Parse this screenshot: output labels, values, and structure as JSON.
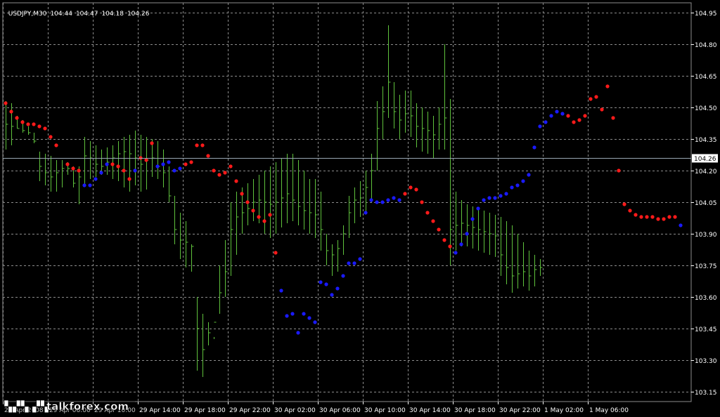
{
  "header": {
    "symbol": "USDJPY,M30",
    "open": "104.44",
    "high": "104.47",
    "low": "104.18",
    "close": "104.26"
  },
  "price_label": "104.26",
  "colors": {
    "background": "#000000",
    "grid": "#8c8c8c",
    "bars": "#5fc23c",
    "sar_above": "#ff1a1a",
    "sar_below": "#1a1aff",
    "axis": "#ffffff",
    "price_line": "#9aa7b4"
  },
  "watermark": {
    "text": "talkforex.com",
    "icon": "logo-watermark"
  },
  "chart_data": {
    "type": "line",
    "title": "USDJPY,M30",
    "ylim": [
      104.1,
      105.0
    ],
    "y_ticks": [
      "104.95",
      "104.80",
      "104.65",
      "104.50",
      "104.35",
      "104.20",
      "104.05",
      "103.90",
      "103.75",
      "103.60",
      "103.45",
      "103.30",
      "103.15"
    ],
    "x_tick_labels": [
      "29 Apr 2008",
      "29 Apr 06:00",
      "29 Apr 10:00",
      "29 Apr 14:00",
      "29 Apr 18:00",
      "29 Apr 22:00",
      "30 Apr 02:00",
      "30 Apr 06:00",
      "30 Apr 10:00",
      "30 Apr 14:00",
      "30 Apr 18:00",
      "30 Apr 22:00",
      "1 May 02:00",
      "1 May 06:00"
    ],
    "grid": true,
    "current_price": 104.26,
    "series": [
      {
        "type": "hlc-bars",
        "high": [
          104.53,
          104.52,
          104.46,
          104.44,
          104.41,
          104.38,
          104.29,
          104.28,
          104.27,
          104.25,
          104.25,
          104.24,
          104.22,
          104.22,
          104.36,
          104.34,
          104.32,
          104.3,
          104.31,
          104.32,
          104.34,
          104.36,
          104.37,
          104.39,
          104.37,
          104.36,
          104.35,
          104.34,
          104.3,
          104.22,
          104.08,
          104.0,
          103.96,
          103.85,
          103.6,
          103.52,
          103.48,
          103.41,
          103.75,
          103.87,
          104.05,
          104.1,
          104.12,
          104.14,
          104.16,
          104.18,
          104.2,
          104.22,
          104.24,
          104.26,
          104.28,
          104.28,
          104.25,
          104.2,
          104.16,
          104.16,
          104.1,
          103.9,
          103.85,
          103.87,
          103.94,
          104.08,
          104.12,
          104.15,
          104.2,
          104.28,
          104.53,
          104.6,
          104.89,
          104.62,
          104.56,
          104.58,
          104.58,
          104.52,
          104.5,
          104.48,
          104.46,
          104.5,
          104.8,
          104.54,
          104.1,
          104.06,
          104.04,
          104.03,
          104.02,
          104.01,
          104.0,
          103.99,
          103.98,
          103.96,
          103.94,
          103.9,
          103.86,
          103.82,
          103.8,
          103.78
        ],
        "low": [
          104.3,
          104.32,
          104.4,
          104.38,
          104.37,
          104.33,
          104.15,
          104.13,
          104.1,
          104.1,
          104.12,
          104.18,
          104.12,
          104.04,
          104.13,
          104.16,
          104.17,
          104.18,
          104.18,
          104.16,
          104.15,
          104.12,
          104.1,
          104.13,
          104.1,
          104.11,
          104.17,
          104.16,
          104.12,
          104.05,
          103.85,
          103.78,
          103.74,
          103.72,
          103.25,
          103.22,
          103.37,
          103.4,
          103.52,
          103.6,
          103.7,
          103.8,
          103.9,
          103.94,
          103.96,
          103.95,
          103.9,
          103.88,
          103.9,
          103.93,
          103.95,
          103.96,
          103.94,
          103.92,
          103.9,
          103.88,
          103.82,
          103.75,
          103.7,
          103.72,
          103.8,
          103.88,
          103.95,
          103.98,
          104.0,
          104.05,
          104.2,
          104.35,
          104.45,
          104.4,
          104.35,
          104.38,
          104.36,
          104.31,
          104.29,
          104.28,
          104.26,
          104.3,
          104.3,
          103.75,
          103.82,
          103.84,
          103.84,
          103.83,
          103.82,
          103.81,
          103.8,
          103.79,
          103.7,
          103.66,
          103.62,
          103.64,
          103.65,
          103.63,
          103.65,
          103.7
        ],
        "close": [
          104.42,
          104.41,
          104.4,
          104.39,
          104.38,
          104.34,
          104.22,
          104.19,
          104.17,
          104.19,
          104.21,
          104.21,
          104.14,
          104.17,
          104.27,
          104.26,
          104.23,
          104.22,
          104.24,
          104.26,
          104.28,
          104.29,
          104.28,
          104.26,
          104.23,
          104.25,
          104.26,
          104.22,
          104.19,
          104.08,
          103.92,
          103.87,
          103.86,
          103.84,
          103.45,
          103.35,
          103.43,
          103.48,
          103.62,
          103.72,
          103.92,
          103.98,
          104.0,
          104.02,
          104.05,
          104.06,
          104.05,
          104.04,
          104.05,
          104.07,
          104.09,
          104.06,
          104.03,
          104.01,
          104.0,
          103.99,
          103.92,
          103.82,
          103.8,
          103.83,
          103.9,
          104.0,
          104.06,
          104.07,
          104.12,
          104.2,
          104.4,
          104.48,
          104.62,
          104.48,
          104.44,
          104.47,
          104.46,
          104.41,
          104.4,
          104.39,
          104.37,
          104.42,
          104.45,
          103.92,
          103.94,
          103.95,
          103.94,
          103.93,
          103.92,
          103.91,
          103.9,
          103.89,
          103.8,
          103.74,
          103.7,
          103.71,
          103.72,
          103.7,
          103.73,
          103.74
        ]
      },
      {
        "type": "parabolic-sar",
        "x_bar_index": [
          0,
          1,
          2,
          3,
          4,
          5,
          6,
          7,
          8,
          9,
          11,
          12,
          13,
          14,
          15,
          16,
          17,
          18,
          19,
          20,
          21,
          22,
          23,
          24,
          25,
          26,
          27,
          28,
          29,
          30,
          31,
          32,
          33,
          34,
          35,
          36,
          37,
          38,
          39,
          40,
          41,
          42,
          43,
          44,
          45,
          46,
          47,
          48,
          49,
          50,
          51,
          52,
          53,
          54,
          55,
          56,
          57,
          58,
          59,
          60,
          61,
          62,
          63,
          64,
          65,
          66,
          67,
          68,
          69,
          70,
          71,
          72,
          73,
          74,
          75,
          76,
          77,
          78,
          79,
          80,
          81,
          82,
          83,
          84,
          85,
          86,
          87,
          88,
          89,
          90,
          91,
          92,
          93,
          94,
          95,
          96,
          97,
          98,
          99,
          100,
          101,
          102,
          103,
          104,
          105,
          106,
          107,
          108,
          109,
          110,
          111,
          112,
          113,
          114,
          115,
          116,
          117,
          118,
          119,
          120
        ],
        "values": [
          104.52,
          104.48,
          104.45,
          104.43,
          104.42,
          104.42,
          104.41,
          104.4,
          104.36,
          104.32,
          104.23,
          104.21,
          104.2,
          104.13,
          104.13,
          104.16,
          104.19,
          104.23,
          104.23,
          104.22,
          104.2,
          104.16,
          104.2,
          104.26,
          104.25,
          104.33,
          104.22,
          104.23,
          104.24,
          104.2,
          104.21,
          104.23,
          104.24,
          104.32,
          104.32,
          104.27,
          104.2,
          104.18,
          104.19,
          104.22,
          104.15,
          104.09,
          104.05,
          104.01,
          103.98,
          103.96,
          103.99,
          103.81,
          103.63,
          103.51,
          103.52,
          103.43,
          103.52,
          103.5,
          103.48,
          103.67,
          103.66,
          103.61,
          103.64,
          103.7,
          103.76,
          103.76,
          103.78,
          104.0,
          104.06,
          104.05,
          104.05,
          104.06,
          104.07,
          104.06,
          104.09,
          104.12,
          104.11,
          104.05,
          104.0,
          103.96,
          103.92,
          103.87,
          103.84,
          103.81,
          103.85,
          103.9,
          103.97,
          104.02,
          104.06,
          104.07,
          104.07,
          104.08,
          104.09,
          104.12,
          104.13,
          104.15,
          104.18,
          104.31,
          104.41,
          104.43,
          104.46,
          104.48,
          104.47,
          104.46,
          104.43,
          104.44,
          104.46,
          104.54,
          104.55,
          104.49,
          104.6,
          104.45,
          104.2,
          104.04,
          104.01,
          103.99,
          103.98,
          103.98,
          103.98,
          103.97,
          103.97,
          103.98,
          103.98,
          103.94
        ],
        "position": [
          "a",
          "a",
          "a",
          "a",
          "a",
          "a",
          "a",
          "a",
          "a",
          "a",
          "a",
          "a",
          "a",
          "b",
          "b",
          "b",
          "b",
          "b",
          "a",
          "a",
          "a",
          "a",
          "b",
          "a",
          "a",
          "a",
          "b",
          "b",
          "b",
          "b",
          "b",
          "a",
          "a",
          "a",
          "a",
          "a",
          "a",
          "a",
          "a",
          "a",
          "a",
          "a",
          "a",
          "a",
          "a",
          "a",
          "a",
          "a",
          "b",
          "b",
          "b",
          "b",
          "b",
          "b",
          "b",
          "b",
          "b",
          "b",
          "b",
          "b",
          "b",
          "b",
          "b",
          "b",
          "b",
          "b",
          "b",
          "b",
          "b",
          "b",
          "a",
          "a",
          "a",
          "a",
          "a",
          "a",
          "a",
          "a",
          "a",
          "b",
          "b",
          "b",
          "b",
          "b",
          "b",
          "b",
          "b",
          "b",
          "b",
          "b",
          "b",
          "b",
          "b",
          "b",
          "b",
          "b",
          "b",
          "b",
          "b",
          "a",
          "a",
          "a",
          "a",
          "a",
          "a",
          "a",
          "a",
          "a",
          "a",
          "a",
          "a",
          "a",
          "a",
          "a",
          "a",
          "a",
          "a",
          "a",
          "a",
          "b"
        ]
      }
    ]
  }
}
